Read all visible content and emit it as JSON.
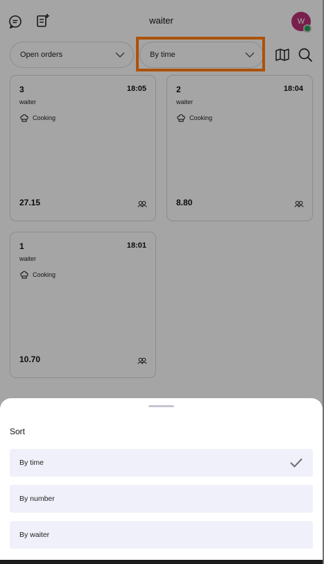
{
  "header": {
    "title": "waiter",
    "avatar_initial": "W",
    "left_icons": [
      "chat-icon",
      "new-order-icon"
    ]
  },
  "toolbar": {
    "filter_value": "Open orders",
    "sort_value": "By time",
    "icons": [
      "map-icon",
      "search-icon"
    ]
  },
  "orders": [
    {
      "number": "3",
      "time": "18:05",
      "waiter": "waiter",
      "status": "Cooking",
      "total": "27.15"
    },
    {
      "number": "2",
      "time": "18:04",
      "waiter": "waiter",
      "status": "Cooking",
      "total": "8.80"
    },
    {
      "number": "1",
      "time": "18:01",
      "waiter": "waiter",
      "status": "Cooking",
      "total": "10.70"
    }
  ],
  "sort_sheet": {
    "title": "Sort",
    "options": [
      {
        "label": "By time",
        "selected": true
      },
      {
        "label": "By number",
        "selected": false
      },
      {
        "label": "By waiter",
        "selected": false
      }
    ]
  },
  "colors": {
    "accent_highlight": "#ff7a0e",
    "avatar": "#b2306f",
    "online_dot": "#1e9a52",
    "option_bg": "#f0f0fa"
  }
}
